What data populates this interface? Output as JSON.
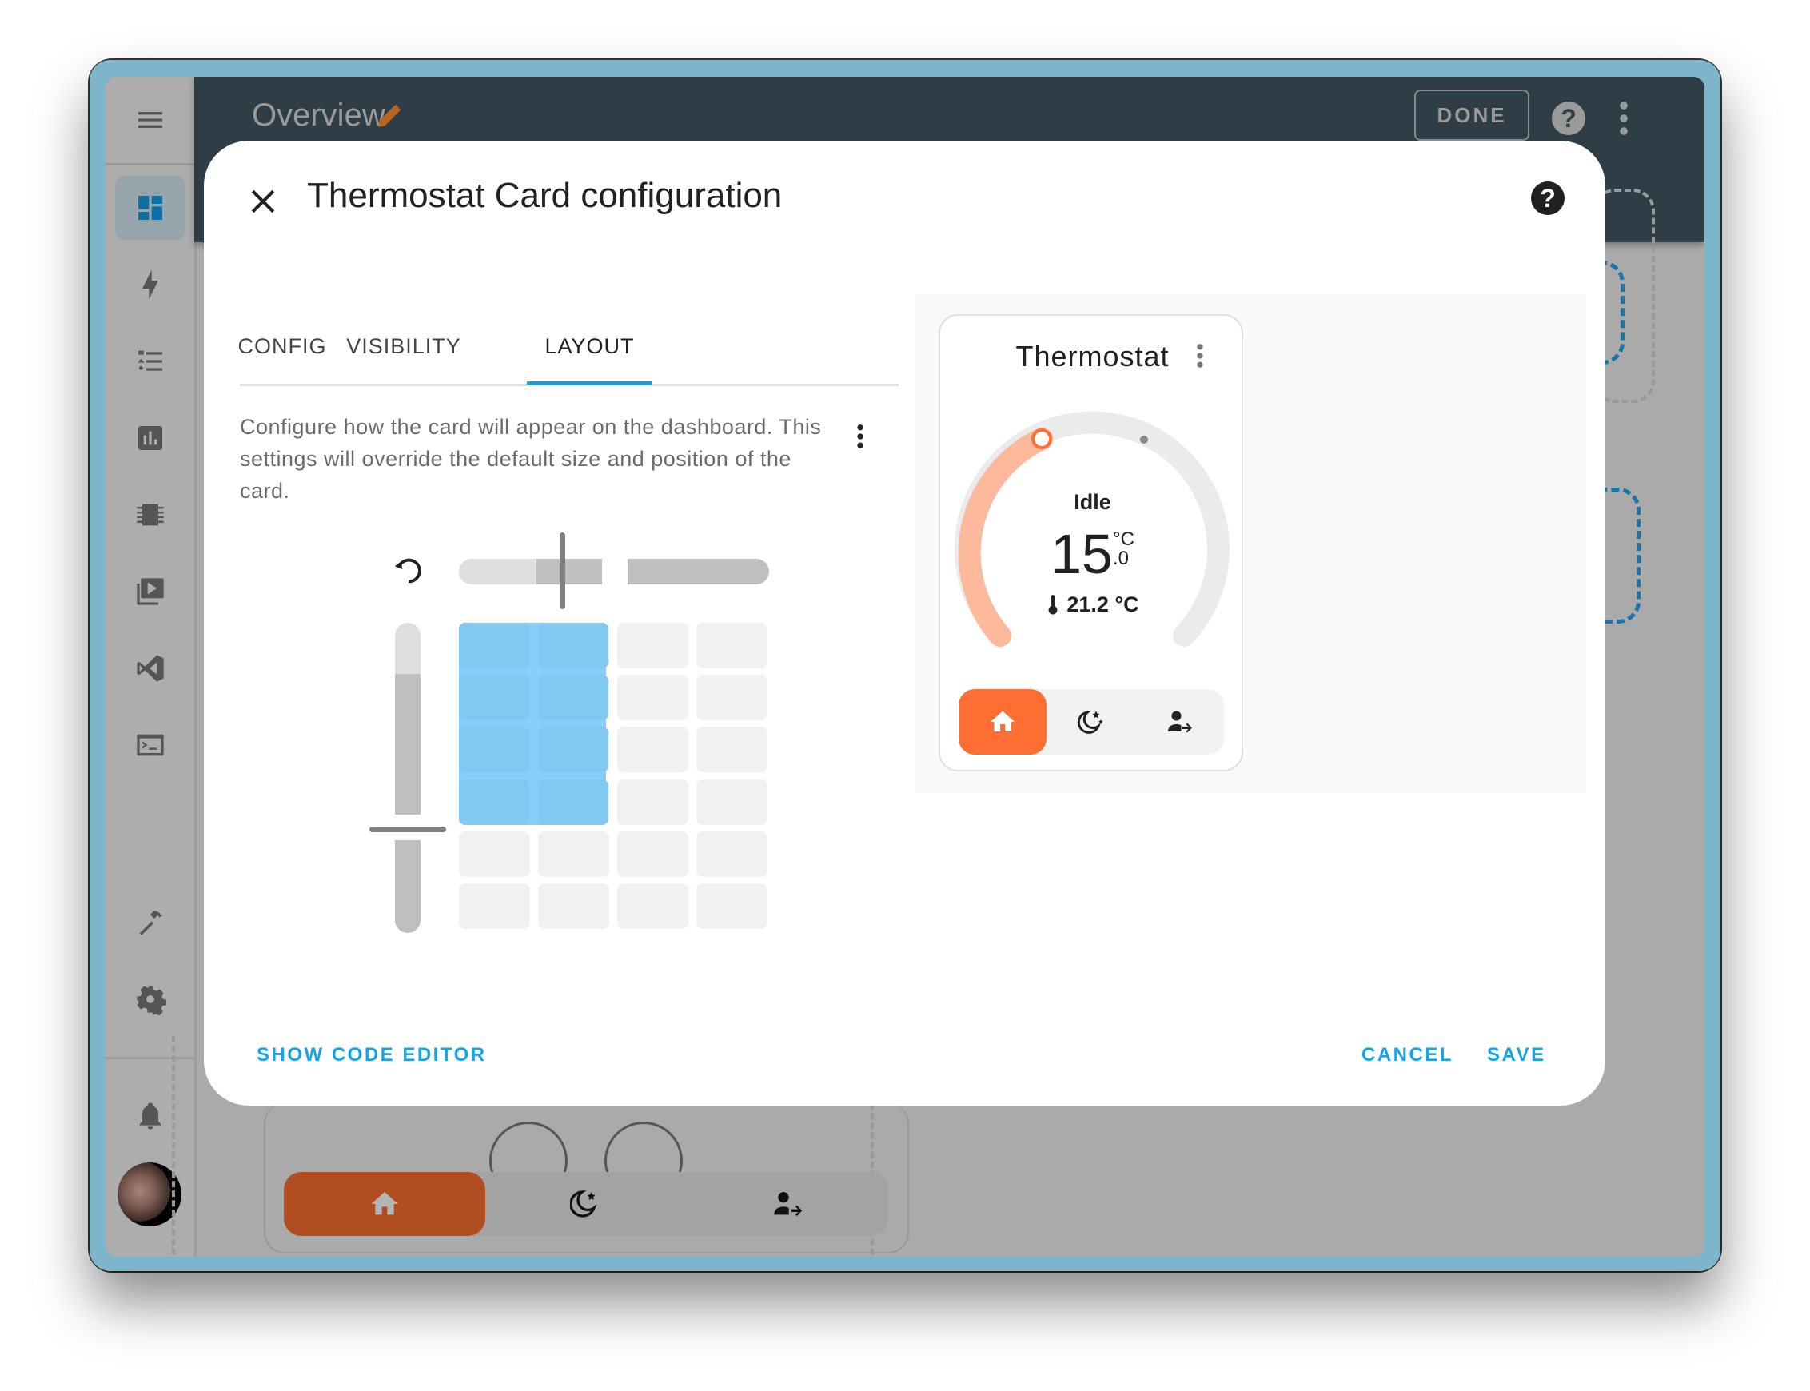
{
  "app": {
    "header": {
      "title": "Overview",
      "done_label": "DONE"
    },
    "sidebar": {
      "items": [
        {
          "name": "overview",
          "icon": "dashboard-icon",
          "active": true
        },
        {
          "name": "energy",
          "icon": "lightning-icon",
          "active": false
        },
        {
          "name": "logbook",
          "icon": "format-list-icon",
          "active": false
        },
        {
          "name": "history",
          "icon": "chart-box-icon",
          "active": false
        },
        {
          "name": "esphome",
          "icon": "chip-icon",
          "active": false
        },
        {
          "name": "media",
          "icon": "play-box-multiple-icon",
          "active": false
        },
        {
          "name": "vscode",
          "icon": "vscode-icon",
          "active": false
        },
        {
          "name": "terminal",
          "icon": "console-icon",
          "active": false
        },
        {
          "name": "developer-tools",
          "icon": "hammer-icon",
          "active": false
        },
        {
          "name": "settings",
          "icon": "gear-icon",
          "active": false
        }
      ],
      "notifications_icon": "bell-icon",
      "user_avatar": "avatar"
    }
  },
  "dialog": {
    "title": "Thermostat Card configuration",
    "tabs": [
      {
        "label": "CONFIG",
        "active": false
      },
      {
        "label": "VISIBILITY",
        "active": false
      },
      {
        "label": "LAYOUT",
        "active": true
      }
    ],
    "description": "Configure how the card will appear on the dashboard. This settings will override the default size and position of the card.",
    "layout_editor": {
      "columns_total": 4,
      "rows_total": 6,
      "selected_columns": 2,
      "selected_rows": 4
    },
    "footer": {
      "show_code_editor": "SHOW CODE EDITOR",
      "cancel": "CANCEL",
      "save": "SAVE"
    },
    "accent_color": "#0ba1e6"
  },
  "preview": {
    "card": {
      "title": "Thermostat",
      "status": "Idle",
      "target_integer": "15",
      "target_decimal": ".0",
      "target_unit": "°C",
      "current_temperature": "21.2 °C",
      "modes": [
        {
          "name": "home",
          "icon": "home-icon",
          "active": true
        },
        {
          "name": "sleep",
          "icon": "moon-stars-icon",
          "active": false
        },
        {
          "name": "away",
          "icon": "account-arrow-right-icon",
          "active": false
        }
      ],
      "active_color": "#ff6f34",
      "arc_color": "#fdb99b"
    }
  }
}
